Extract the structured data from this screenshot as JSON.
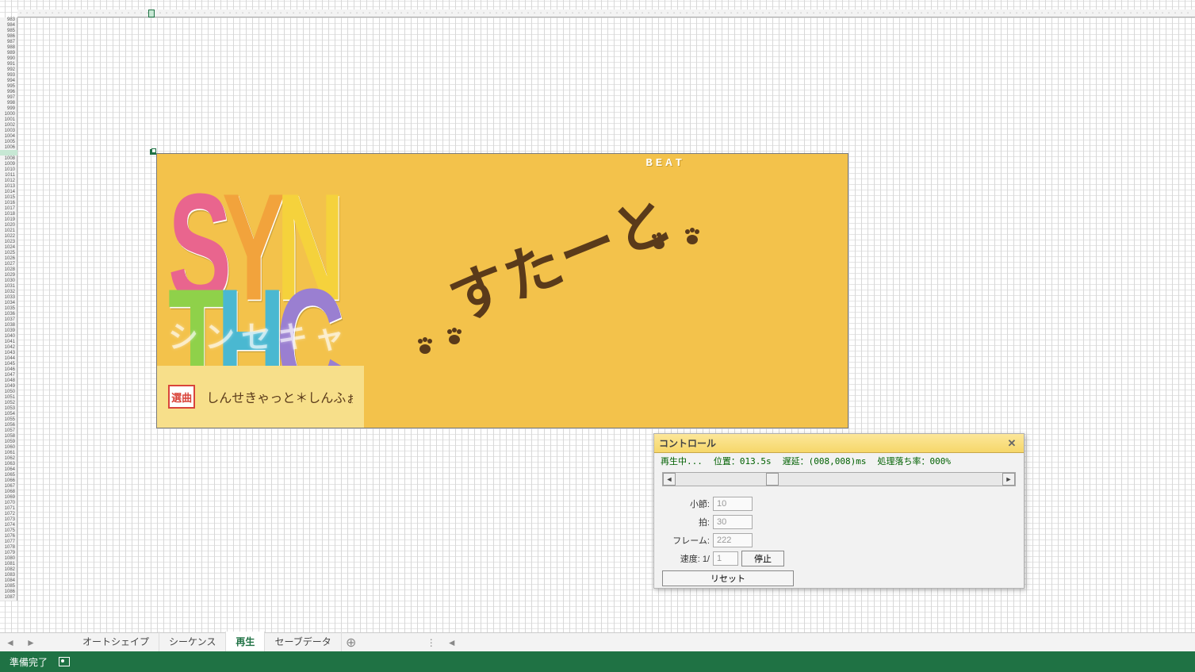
{
  "sheet": {
    "first_row": 983,
    "row_count": 105,
    "col_count": 185,
    "selected_cell": "Y999"
  },
  "game": {
    "beat_label": "BEAT",
    "logo_letters": [
      "S",
      "Y",
      "N",
      "T",
      "H",
      "C"
    ],
    "subtitle": "シンセキャ",
    "start_text": "すたーと",
    "song_button": "選曲",
    "song_title": "しんせきゃっと＊しんふぉに"
  },
  "control": {
    "title": "コントロール",
    "status_playing": "再生中...",
    "status_position_label": "位置：",
    "status_position_value": "013.5s",
    "status_delay_label": "遅延：",
    "status_delay_value": "(008,008)ms",
    "status_drop_label": "処理落ち率：",
    "status_drop_value": "000%",
    "label_bar": "小節:",
    "value_bar": "10",
    "label_beat": "拍:",
    "value_beat": "30",
    "label_frame": "フレーム:",
    "value_frame": "222",
    "label_speed": "速度: 1/",
    "value_speed": "1",
    "button_stop": "停止",
    "button_reset": "リセット"
  },
  "tabs": {
    "items": [
      "オートシェイプ",
      "シーケンス",
      "再生",
      "セーブデータ"
    ],
    "active_index": 2
  },
  "statusbar": {
    "ready": "準備完了"
  }
}
